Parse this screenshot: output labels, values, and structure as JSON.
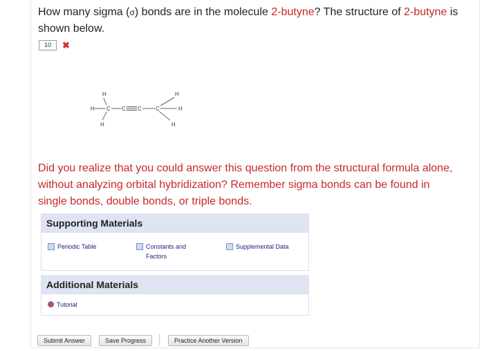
{
  "question": {
    "part1": "How many sigma (",
    "sigma_symbol": "σ",
    "part2": ") bonds are in the molecule ",
    "molecule_name": "2-butyne",
    "part3": "? The structure of ",
    "molecule_name_2": "2-butyne",
    "part4": " is shown below."
  },
  "answer": {
    "value": "10",
    "status": "incorrect",
    "status_symbol": "✖"
  },
  "molecule": {
    "top_left_h": "H",
    "left_h": "H",
    "bottom_left_h": "H",
    "c1": "C",
    "c2": "C",
    "c3": "C",
    "c4": "C",
    "top_right_h": "H",
    "right_h": "H",
    "bottom_right_h": "H"
  },
  "feedback": "Did you realize that you could answer this question from the structural formula alone, without analyzing orbital hybridization? Remember sigma bonds can be found in single bonds, double bonds, or triple bonds.",
  "supporting": {
    "title": "Supporting Materials",
    "links": [
      "Periodic Table",
      "Constants and Factors",
      "Supplemental Data"
    ]
  },
  "additional": {
    "title": "Additional Materials",
    "links": [
      "Tutorial"
    ]
  },
  "buttons": {
    "submit": "Submit Answer",
    "save": "Save Progress",
    "practice": "Practice Another Version"
  },
  "colors": {
    "accent_red": "#c62828",
    "panel_header": "#dfe4f2",
    "link_blue": "#1a237e"
  }
}
